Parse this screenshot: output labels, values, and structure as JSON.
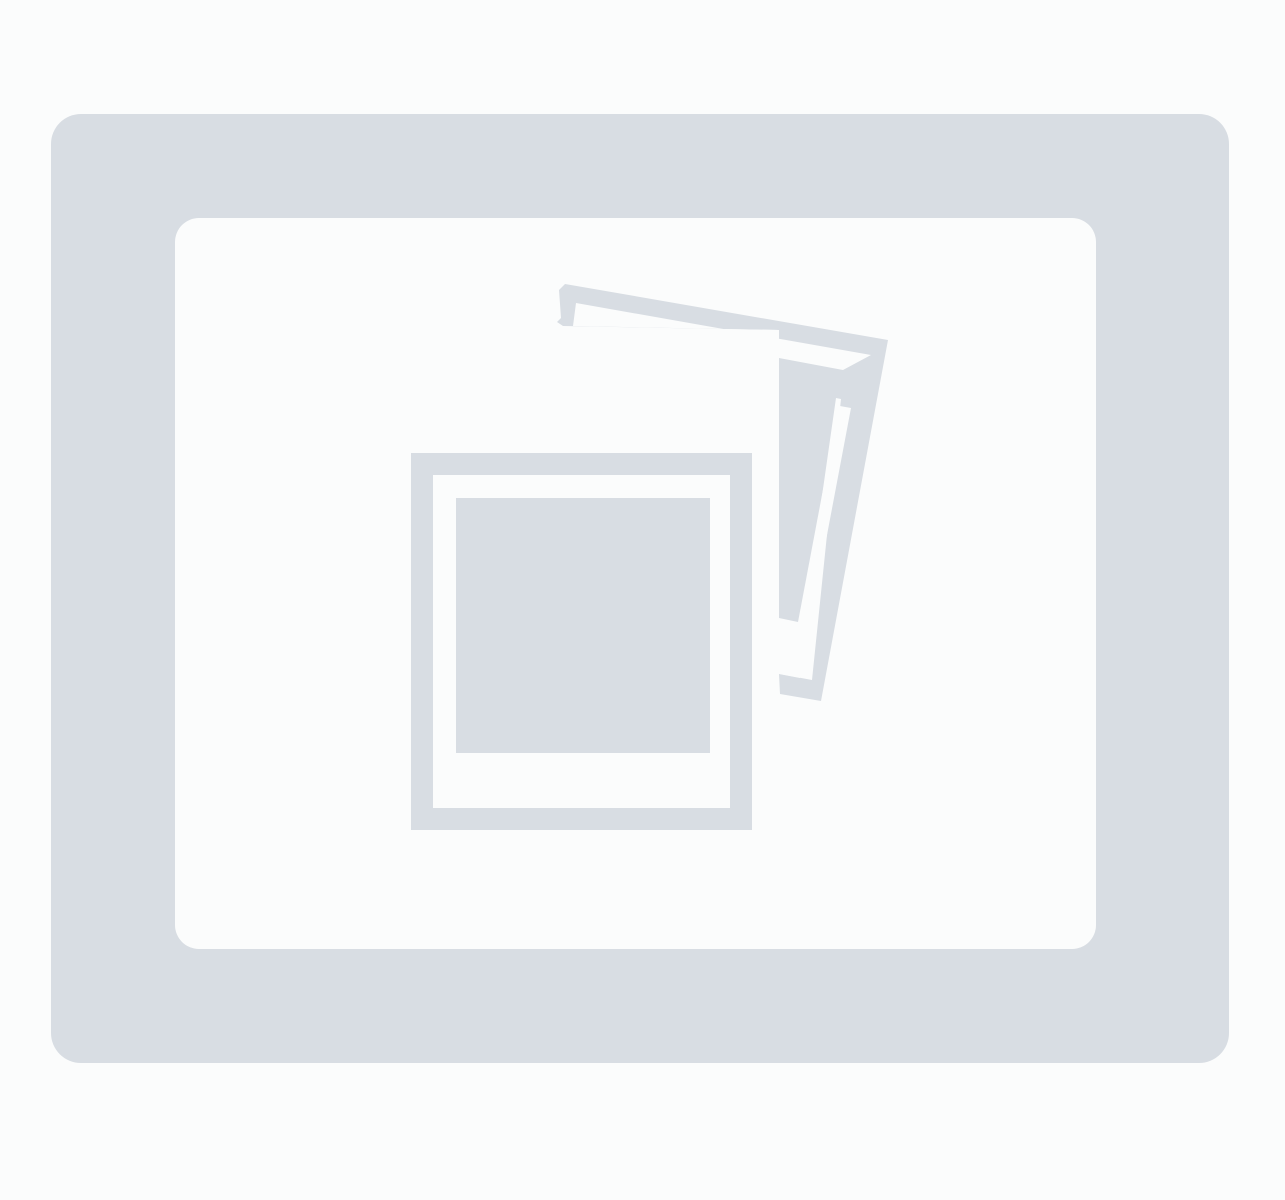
{
  "placeholder": {
    "icon": "photos-placeholder-icon",
    "colors": {
      "page_background": "#fbfcfc",
      "frame": "#d8dde3",
      "inner_panel": "#fbfcfc"
    }
  }
}
